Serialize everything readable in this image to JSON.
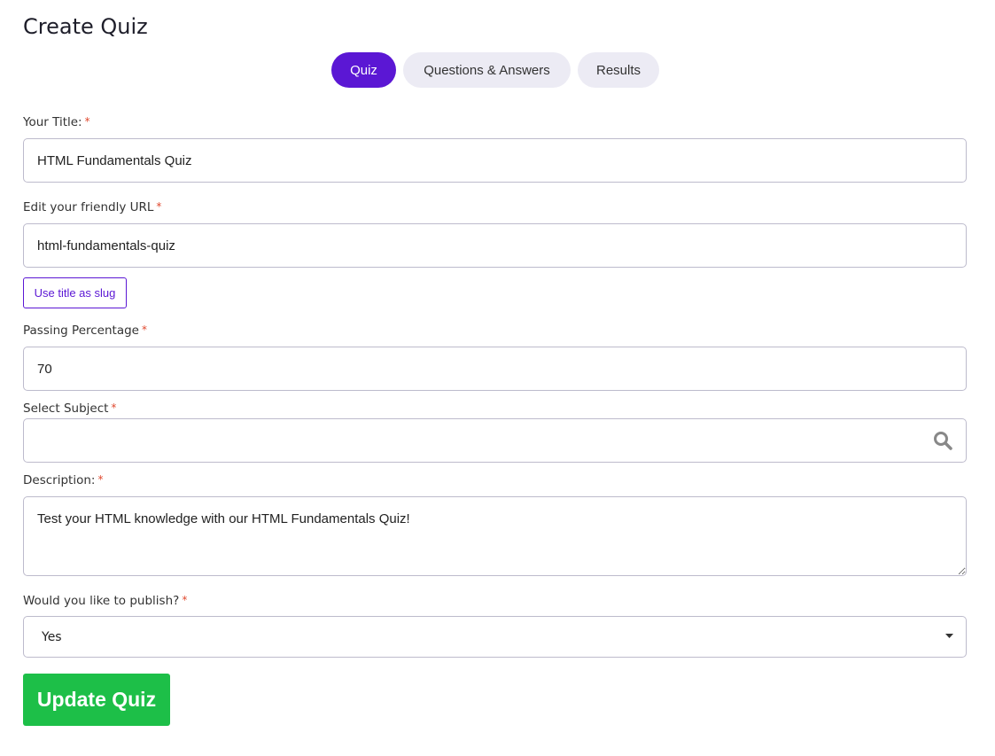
{
  "page_title": "Create Quiz",
  "tabs": [
    {
      "label": "Quiz",
      "active": true
    },
    {
      "label": "Questions & Answers",
      "active": false
    },
    {
      "label": "Results",
      "active": false
    }
  ],
  "form": {
    "title": {
      "label": "Your Title:",
      "value": "HTML Fundamentals Quiz"
    },
    "url": {
      "label": "Edit your friendly URL",
      "value": "html-fundamentals-quiz",
      "slug_button": "Use title as slug"
    },
    "passing": {
      "label": "Passing Percentage",
      "value": "70"
    },
    "subject": {
      "label": "Select Subject",
      "value": "",
      "icon": "search-icon"
    },
    "description": {
      "label": "Description:",
      "value": "Test your HTML knowledge with our HTML Fundamentals Quiz!"
    },
    "publish": {
      "label": "Would you like to publish?",
      "value": "Yes"
    },
    "required_mark": "*",
    "submit_label": "Update Quiz"
  },
  "colors": {
    "accent": "#5b17d4",
    "submit": "#1dbf48",
    "required": "#e0492f"
  }
}
